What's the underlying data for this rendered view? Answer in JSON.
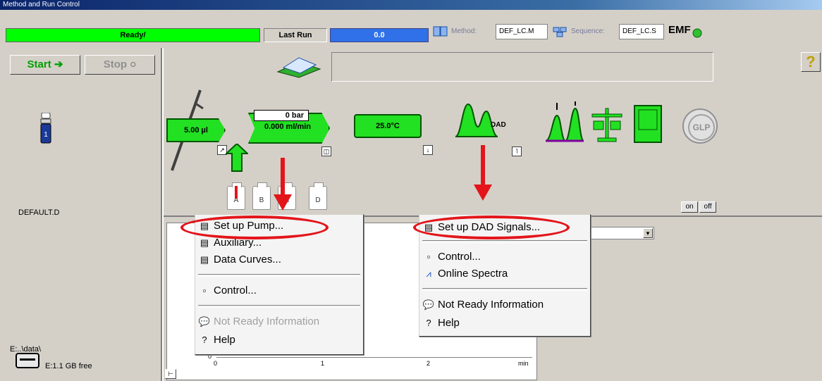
{
  "window": {
    "title": "Method and Run Control"
  },
  "status": {
    "ready_text": "Ready/",
    "last_run_label": "Last Run",
    "last_run_value": "0.0",
    "method_label": "Method:",
    "method_value": "DEF_LC.M",
    "sequence_label": "Sequence:",
    "sequence_value": "DEF_LC.S",
    "emf_label": "EMF"
  },
  "toolbar": {
    "start_label": "Start",
    "stop_label": "Stop"
  },
  "left_panel": {
    "vial_number": "1",
    "data_file": "DEFAULT.D",
    "data_path": "E:..\\data\\",
    "disk_free": "E:1.1 GB free"
  },
  "instrument": {
    "injector_volume": "5.00 µl",
    "pump_pressure": "0 bar",
    "pump_flow": "0.000 ml/min",
    "column_temp": "25.0°C",
    "detector_label": "DAD",
    "solvent_bottles": [
      "A",
      "B",
      "C",
      "D"
    ],
    "on_label": "on",
    "off_label": "off",
    "glp_label": "GLP",
    "help_symbol": "?"
  },
  "plot": {
    "x_ticks": [
      "0",
      "1",
      "2"
    ],
    "x_unit": "min",
    "y_tick": "0"
  },
  "pump_menu": {
    "items": [
      {
        "label": "Set up Pump...",
        "icon": "dialog-icon",
        "disabled": false
      },
      {
        "label": "Auxiliary...",
        "icon": "dialog-icon",
        "disabled": false
      },
      {
        "label": "Data Curves...",
        "icon": "dialog-icon",
        "disabled": false
      },
      {
        "label": "Control...",
        "icon": "control-icon",
        "disabled": false
      },
      {
        "label": "Not Ready Information",
        "icon": "speech-bubble-icon",
        "disabled": true
      },
      {
        "label": "Help",
        "icon": "help-icon",
        "disabled": false
      }
    ]
  },
  "dad_menu": {
    "items": [
      {
        "label": "Set up DAD Signals...",
        "icon": "dialog-icon",
        "disabled": false
      },
      {
        "label": "Control...",
        "icon": "control-icon",
        "disabled": false
      },
      {
        "label": "Online Spectra",
        "icon": "spectrum-icon",
        "disabled": false
      },
      {
        "label": "Not Ready Information",
        "icon": "speech-bubble-icon",
        "disabled": false
      },
      {
        "label": "Help",
        "icon": "help-icon",
        "disabled": false
      }
    ]
  },
  "colors": {
    "ready": "#00ff00",
    "module_green": "#22e022",
    "last_run": "#3070e8",
    "annotation_red": "#e3151a"
  }
}
